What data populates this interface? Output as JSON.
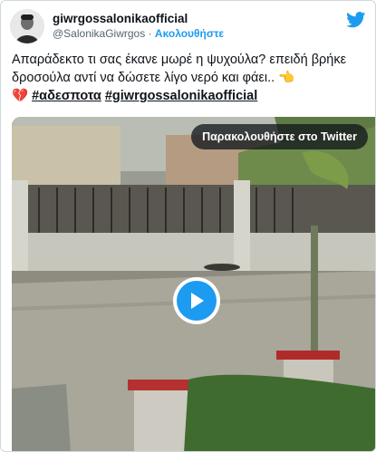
{
  "author": {
    "display_name": "giwrgossalonikaofficial",
    "handle": "@SalonikaGiwrgos",
    "separator": " · ",
    "follow_label": "Ακολουθήστε"
  },
  "tweet": {
    "text_line": "Απαράδεκτο τι σας έκανε μωρέ η ψυχούλα? επειδή βρήκε δροσούλα αντί να δώσετε λίγο νερό και φάει..",
    "emoji_point": "👈",
    "emoji_heart": "💔",
    "hashtag_1": "#αδεσποτα",
    "hashtag_2": "#giwrgossalonikaofficial"
  },
  "media": {
    "watch_label": "Παρακολουθήστε στο Twitter"
  },
  "icons": {
    "logo": "twitter-bird-icon",
    "play": "play-icon"
  },
  "colors": {
    "accent": "#1d9bf0",
    "text": "#0f1419",
    "muted": "#536471"
  }
}
